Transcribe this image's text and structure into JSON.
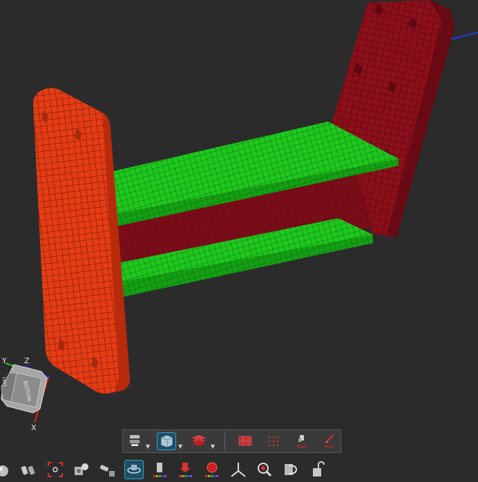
{
  "app": {
    "background": "#2b2b2b"
  },
  "colors": {
    "flange_left": "#e63c14",
    "flange_right": "#8c0f1a",
    "plates": "#1ec81e",
    "web": "#7a0d18",
    "mesh_line": "#2a0b05",
    "axis_x": "#e02020",
    "axis_y": "#20c020",
    "axis_z": "#2040e0"
  },
  "view_cube": {
    "axis_labels": {
      "x": "X",
      "y": "Y",
      "z": "Z"
    },
    "face_front": "BOTTOM",
    "face_side": "LEFT"
  },
  "floating_toolbar": {
    "buttons": [
      {
        "name": "slice-view-button",
        "icon": "slice-icon"
      },
      {
        "name": "display-mode-button",
        "icon": "cube-icon",
        "active": true
      },
      {
        "name": "layers-button",
        "icon": "layers-icon"
      },
      {
        "name": "mesh-elements-button",
        "icon": "mesh-cubes-icon"
      },
      {
        "name": "mesh-nodes-button",
        "icon": "node-dots-icon"
      },
      {
        "name": "text-label-button",
        "icon": "text-block-icon",
        "label": "Text"
      },
      {
        "name": "text-annotate-button",
        "icon": "pen-icon",
        "label": "Text"
      }
    ]
  },
  "bottom_toolbar": {
    "icons": [
      "sphere-icon",
      "binoculars-icon",
      "focus-target-icon",
      "camera-settings-icon",
      "camera-move-icon",
      "rotate-view-icon",
      "contour-plot-icon",
      "deformation-icon",
      "legend-icon",
      "axis-triad-icon",
      "zoom-icon",
      "3d-view-icon",
      "unlock-icon"
    ]
  }
}
